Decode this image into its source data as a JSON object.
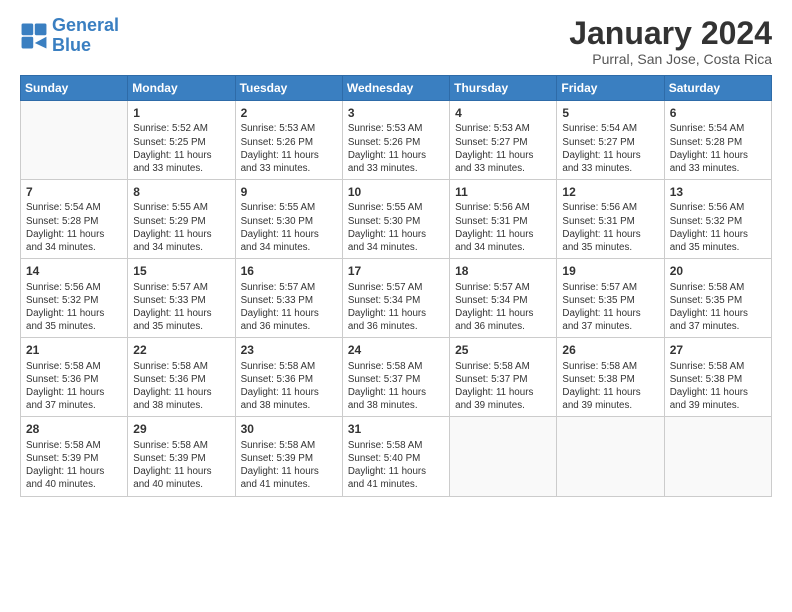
{
  "header": {
    "logo_line1": "General",
    "logo_line2": "Blue",
    "title": "January 2024",
    "subtitle": "Purral, San Jose, Costa Rica"
  },
  "columns": [
    "Sunday",
    "Monday",
    "Tuesday",
    "Wednesday",
    "Thursday",
    "Friday",
    "Saturday"
  ],
  "weeks": [
    [
      {
        "day": "",
        "info": ""
      },
      {
        "day": "1",
        "info": "Sunrise: 5:52 AM\nSunset: 5:25 PM\nDaylight: 11 hours\nand 33 minutes."
      },
      {
        "day": "2",
        "info": "Sunrise: 5:53 AM\nSunset: 5:26 PM\nDaylight: 11 hours\nand 33 minutes."
      },
      {
        "day": "3",
        "info": "Sunrise: 5:53 AM\nSunset: 5:26 PM\nDaylight: 11 hours\nand 33 minutes."
      },
      {
        "day": "4",
        "info": "Sunrise: 5:53 AM\nSunset: 5:27 PM\nDaylight: 11 hours\nand 33 minutes."
      },
      {
        "day": "5",
        "info": "Sunrise: 5:54 AM\nSunset: 5:27 PM\nDaylight: 11 hours\nand 33 minutes."
      },
      {
        "day": "6",
        "info": "Sunrise: 5:54 AM\nSunset: 5:28 PM\nDaylight: 11 hours\nand 33 minutes."
      }
    ],
    [
      {
        "day": "7",
        "info": "Sunrise: 5:54 AM\nSunset: 5:28 PM\nDaylight: 11 hours\nand 34 minutes."
      },
      {
        "day": "8",
        "info": "Sunrise: 5:55 AM\nSunset: 5:29 PM\nDaylight: 11 hours\nand 34 minutes."
      },
      {
        "day": "9",
        "info": "Sunrise: 5:55 AM\nSunset: 5:30 PM\nDaylight: 11 hours\nand 34 minutes."
      },
      {
        "day": "10",
        "info": "Sunrise: 5:55 AM\nSunset: 5:30 PM\nDaylight: 11 hours\nand 34 minutes."
      },
      {
        "day": "11",
        "info": "Sunrise: 5:56 AM\nSunset: 5:31 PM\nDaylight: 11 hours\nand 34 minutes."
      },
      {
        "day": "12",
        "info": "Sunrise: 5:56 AM\nSunset: 5:31 PM\nDaylight: 11 hours\nand 35 minutes."
      },
      {
        "day": "13",
        "info": "Sunrise: 5:56 AM\nSunset: 5:32 PM\nDaylight: 11 hours\nand 35 minutes."
      }
    ],
    [
      {
        "day": "14",
        "info": "Sunrise: 5:56 AM\nSunset: 5:32 PM\nDaylight: 11 hours\nand 35 minutes."
      },
      {
        "day": "15",
        "info": "Sunrise: 5:57 AM\nSunset: 5:33 PM\nDaylight: 11 hours\nand 35 minutes."
      },
      {
        "day": "16",
        "info": "Sunrise: 5:57 AM\nSunset: 5:33 PM\nDaylight: 11 hours\nand 36 minutes."
      },
      {
        "day": "17",
        "info": "Sunrise: 5:57 AM\nSunset: 5:34 PM\nDaylight: 11 hours\nand 36 minutes."
      },
      {
        "day": "18",
        "info": "Sunrise: 5:57 AM\nSunset: 5:34 PM\nDaylight: 11 hours\nand 36 minutes."
      },
      {
        "day": "19",
        "info": "Sunrise: 5:57 AM\nSunset: 5:35 PM\nDaylight: 11 hours\nand 37 minutes."
      },
      {
        "day": "20",
        "info": "Sunrise: 5:58 AM\nSunset: 5:35 PM\nDaylight: 11 hours\nand 37 minutes."
      }
    ],
    [
      {
        "day": "21",
        "info": "Sunrise: 5:58 AM\nSunset: 5:36 PM\nDaylight: 11 hours\nand 37 minutes."
      },
      {
        "day": "22",
        "info": "Sunrise: 5:58 AM\nSunset: 5:36 PM\nDaylight: 11 hours\nand 38 minutes."
      },
      {
        "day": "23",
        "info": "Sunrise: 5:58 AM\nSunset: 5:36 PM\nDaylight: 11 hours\nand 38 minutes."
      },
      {
        "day": "24",
        "info": "Sunrise: 5:58 AM\nSunset: 5:37 PM\nDaylight: 11 hours\nand 38 minutes."
      },
      {
        "day": "25",
        "info": "Sunrise: 5:58 AM\nSunset: 5:37 PM\nDaylight: 11 hours\nand 39 minutes."
      },
      {
        "day": "26",
        "info": "Sunrise: 5:58 AM\nSunset: 5:38 PM\nDaylight: 11 hours\nand 39 minutes."
      },
      {
        "day": "27",
        "info": "Sunrise: 5:58 AM\nSunset: 5:38 PM\nDaylight: 11 hours\nand 39 minutes."
      }
    ],
    [
      {
        "day": "28",
        "info": "Sunrise: 5:58 AM\nSunset: 5:39 PM\nDaylight: 11 hours\nand 40 minutes."
      },
      {
        "day": "29",
        "info": "Sunrise: 5:58 AM\nSunset: 5:39 PM\nDaylight: 11 hours\nand 40 minutes."
      },
      {
        "day": "30",
        "info": "Sunrise: 5:58 AM\nSunset: 5:39 PM\nDaylight: 11 hours\nand 41 minutes."
      },
      {
        "day": "31",
        "info": "Sunrise: 5:58 AM\nSunset: 5:40 PM\nDaylight: 11 hours\nand 41 minutes."
      },
      {
        "day": "",
        "info": ""
      },
      {
        "day": "",
        "info": ""
      },
      {
        "day": "",
        "info": ""
      }
    ]
  ]
}
